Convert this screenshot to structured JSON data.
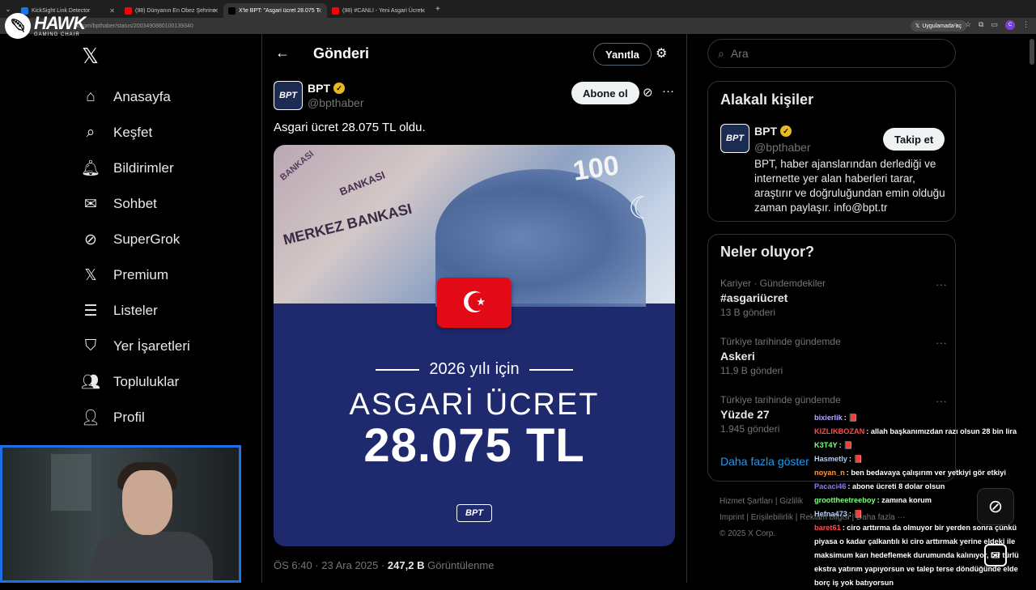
{
  "browser": {
    "tabs": [
      {
        "label": "KickSight Link Detector",
        "color": "#1a73e8"
      },
      {
        "label": "(98) Dünyanın En Obez Şehrine",
        "color": "#ff0000"
      },
      {
        "label": "X'te BPT: \"Asgari ücret 28.075 T",
        "color": "#000000"
      },
      {
        "label": "(98) #CANLI - Yeni Asgari Ücret",
        "color": "#ff0000"
      }
    ],
    "url": "x.com/bpthaber/status/2003490880100139340",
    "app_button": "Uygulamada aç"
  },
  "overlay_logo": {
    "title": "HAWK",
    "subtitle": "GAMING CHAIR"
  },
  "nav": {
    "items": [
      {
        "label": "Anasayfa",
        "icon": "home-icon",
        "glyph": "⌂"
      },
      {
        "label": "Keşfet",
        "icon": "search-icon",
        "glyph": "⌕"
      },
      {
        "label": "Bildirimler",
        "icon": "bell-icon",
        "glyph": "🔔︎"
      },
      {
        "label": "Sohbet",
        "icon": "mail-icon",
        "glyph": "✉"
      },
      {
        "label": "SuperGrok",
        "icon": "grok-icon",
        "glyph": "⊘"
      },
      {
        "label": "Premium",
        "icon": "x-icon",
        "glyph": "𝕏"
      },
      {
        "label": "Listeler",
        "icon": "list-icon",
        "glyph": "☰"
      },
      {
        "label": "Yer İşaretleri",
        "icon": "bookmark-icon",
        "glyph": "⛉"
      },
      {
        "label": "Topluluklar",
        "icon": "people-icon",
        "glyph": "👥︎"
      },
      {
        "label": "Profil",
        "icon": "person-icon",
        "glyph": "👤︎"
      }
    ]
  },
  "header": {
    "title": "Gönderi",
    "reply_label": "Yanıtla"
  },
  "post": {
    "name": "BPT",
    "handle": "@bpthaber",
    "subscribe_label": "Abone ol",
    "text": "Asgari ücret 28.075 TL oldu.",
    "image": {
      "bank_text_1": "MERKEZ BANKASI",
      "bank_text_2": "BANKASI",
      "bank_text_3": "BANKASI",
      "note_value": "100",
      "year_text": "2026 yılı için",
      "headline": "ASGARİ ÜCRET",
      "amount": "28.075 TL",
      "logo": "BPT"
    },
    "time": "ÖS 6:40 · 23 Ara 2025 · ",
    "views_value": "247,2 B",
    "views_label": " Görüntülenme"
  },
  "right": {
    "search_placeholder": "Ara",
    "related_title": "Alakalı kişiler",
    "related_person": {
      "name": "BPT",
      "handle": "@bpthaber",
      "follow_label": "Takip et",
      "bio": "BPT, haber ajanslarından derlediği ve internette yer alan haberleri tarar, araştırır ve doğruluğundan emin olduğu zaman paylaşır. info@bpt.tr"
    },
    "trends_title": "Neler oluyor?",
    "trends": [
      {
        "context": "Kariyer · Gündemdekiler",
        "title": "#asgariücret",
        "count": "13 B gönderi"
      },
      {
        "context": "Türkiye tarihinde gündemde",
        "title": "Askeri",
        "count": "11,9 B gönderi"
      },
      {
        "context": "Türkiye tarihinde gündemde",
        "title": "Yüzde 27",
        "count": "1.945 gönderi"
      }
    ],
    "show_more": "Daha fazla göster",
    "footer": {
      "line1": "Hizmet Şartları  |  Gizlilik",
      "line2": "Imprint  |  Erişilebilirlik  |  Reklam bilgisi  |  Daha fazla ···",
      "line3": "© 2025 X Corp."
    }
  },
  "chat": [
    {
      "user": "bixierlik",
      "color": "#b9a7ff",
      "msg": ": 📕"
    },
    {
      "user": "KIZLIKBOZAN",
      "color": "#ff4d4d",
      "msg": ": allah başkanımızdan razı olsun 28 bin lira"
    },
    {
      "user": "K3T4Y",
      "color": "#7fff7f",
      "msg": ": 📕"
    },
    {
      "user": "Hasmetly",
      "color": "#a9d0ff",
      "msg": ": 📕"
    },
    {
      "user": "noyan_n",
      "color": "#ff9a3c",
      "msg": ": ben bedavaya çalışırım ver yetkiyi gör etkiyi"
    },
    {
      "user": "Pacaci46",
      "color": "#8a7bff",
      "msg": ": abone ücreti 8 dolar olsun"
    },
    {
      "user": "groottheetreeboy",
      "color": "#7fff7f",
      "msg": ": zamına korum"
    },
    {
      "user": "Hefna473",
      "color": "#a9d0ff",
      "msg": ": 📕"
    },
    {
      "user": "baret61",
      "color": "#ff4d4d",
      "msg": ": ciro arttırma da olmuyor bir yerden sonra çünkü piyasa o kadar çalkantılı ki ciro arttırmak yerine eldeki ile maksimum karı hedeflemek durumunda kalınıyor, bir türlü ekstra yatırım yapıyorsun ve talep terse döndüğünde elde borç iş yok batıyorsun"
    }
  ]
}
